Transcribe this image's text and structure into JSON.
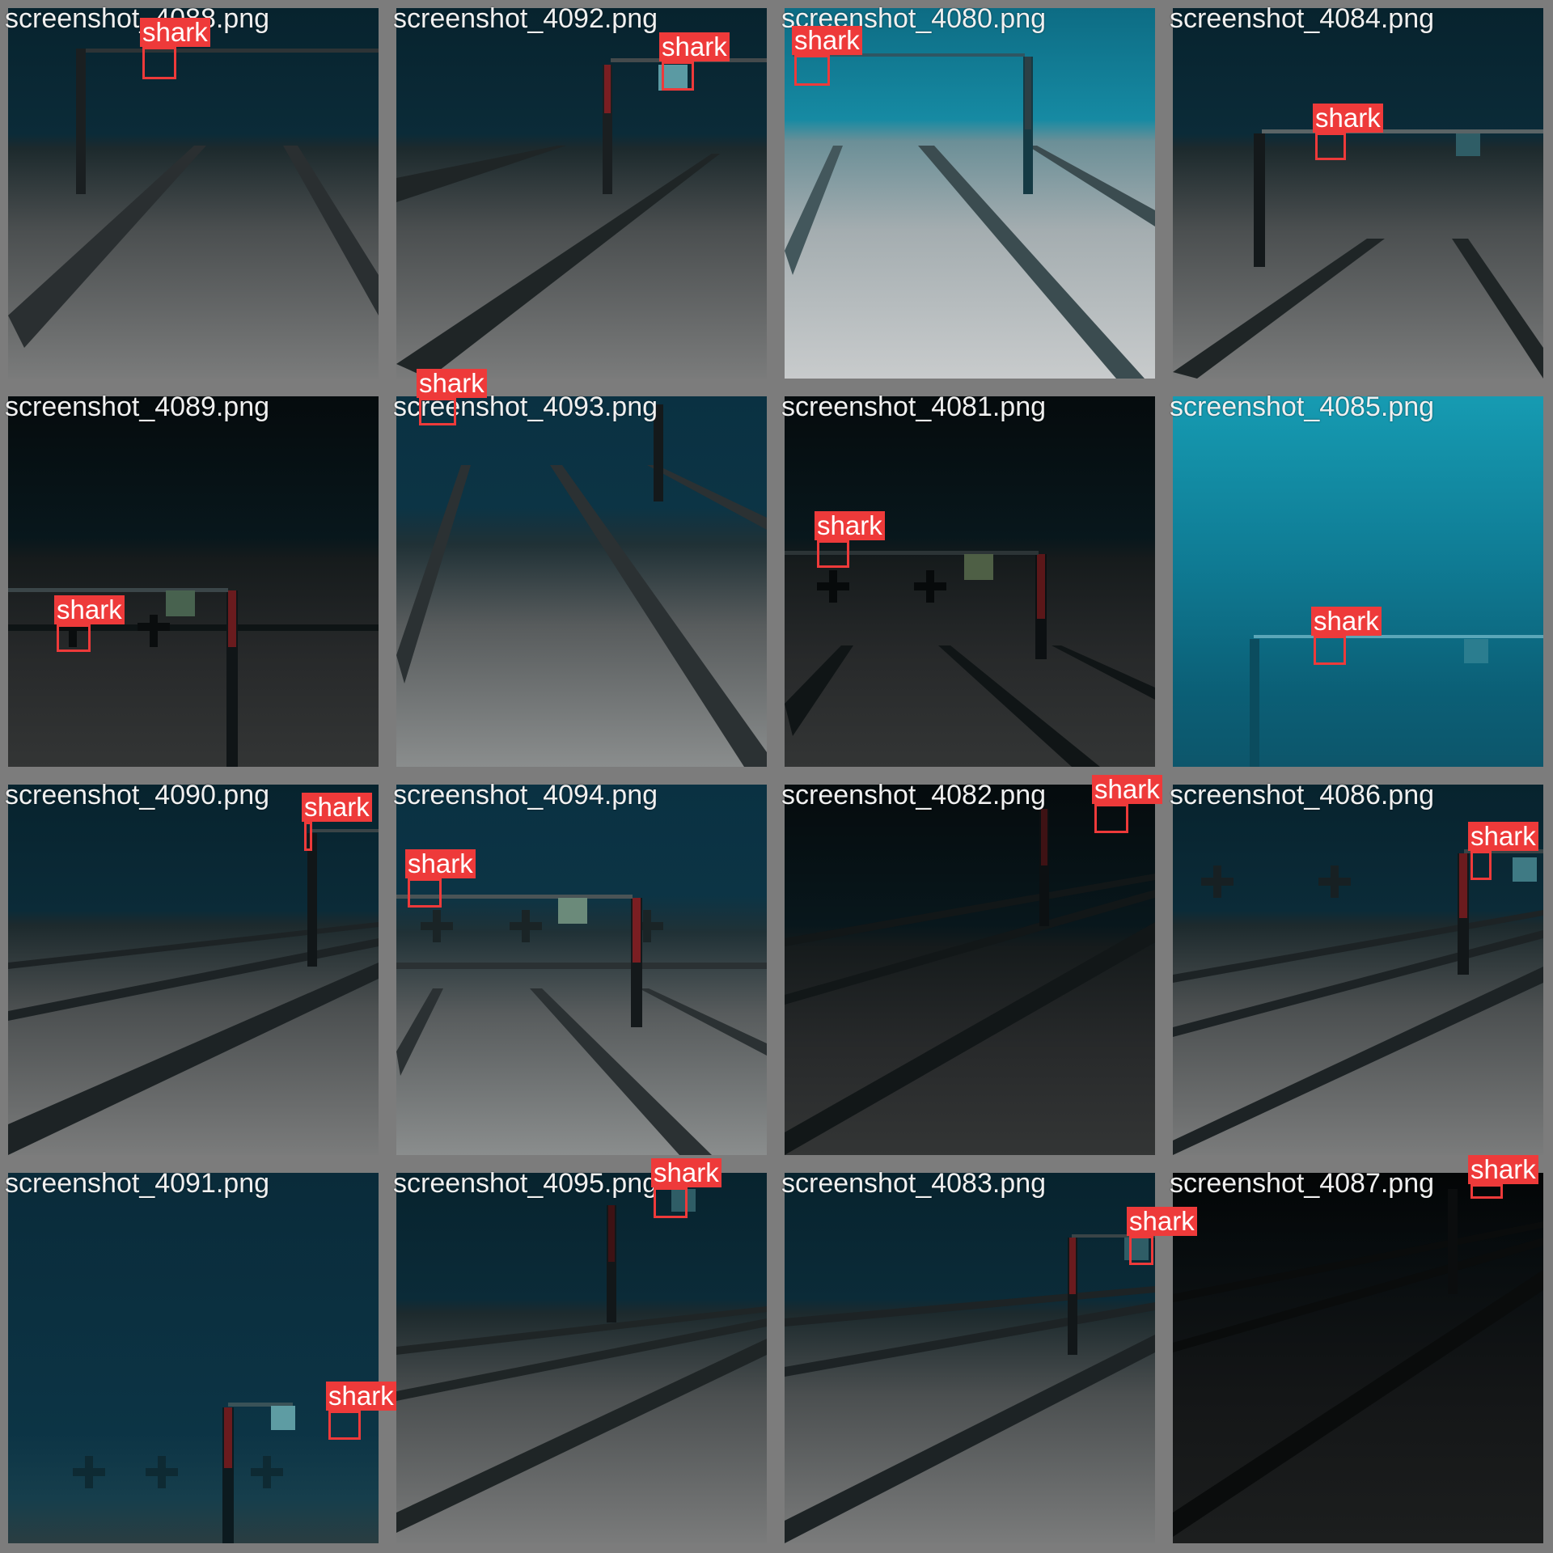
{
  "detection_label": "shark",
  "box_color": "#ee3a3a",
  "tiles": [
    {
      "filename": "screenshot_4088.png"
    },
    {
      "filename": "screenshot_4092.png"
    },
    {
      "filename": "screenshot_4080.png"
    },
    {
      "filename": "screenshot_4084.png"
    },
    {
      "filename": "screenshot_4089.png"
    },
    {
      "filename": "screenshot_4093.png"
    },
    {
      "filename": "screenshot_4081.png"
    },
    {
      "filename": "screenshot_4085.png"
    },
    {
      "filename": "screenshot_4090.png"
    },
    {
      "filename": "screenshot_4094.png"
    },
    {
      "filename": "screenshot_4082.png"
    },
    {
      "filename": "screenshot_4086.png"
    },
    {
      "filename": "screenshot_4091.png"
    },
    {
      "filename": "screenshot_4095.png"
    },
    {
      "filename": "screenshot_4083.png"
    },
    {
      "filename": "screenshot_4087.png"
    }
  ]
}
